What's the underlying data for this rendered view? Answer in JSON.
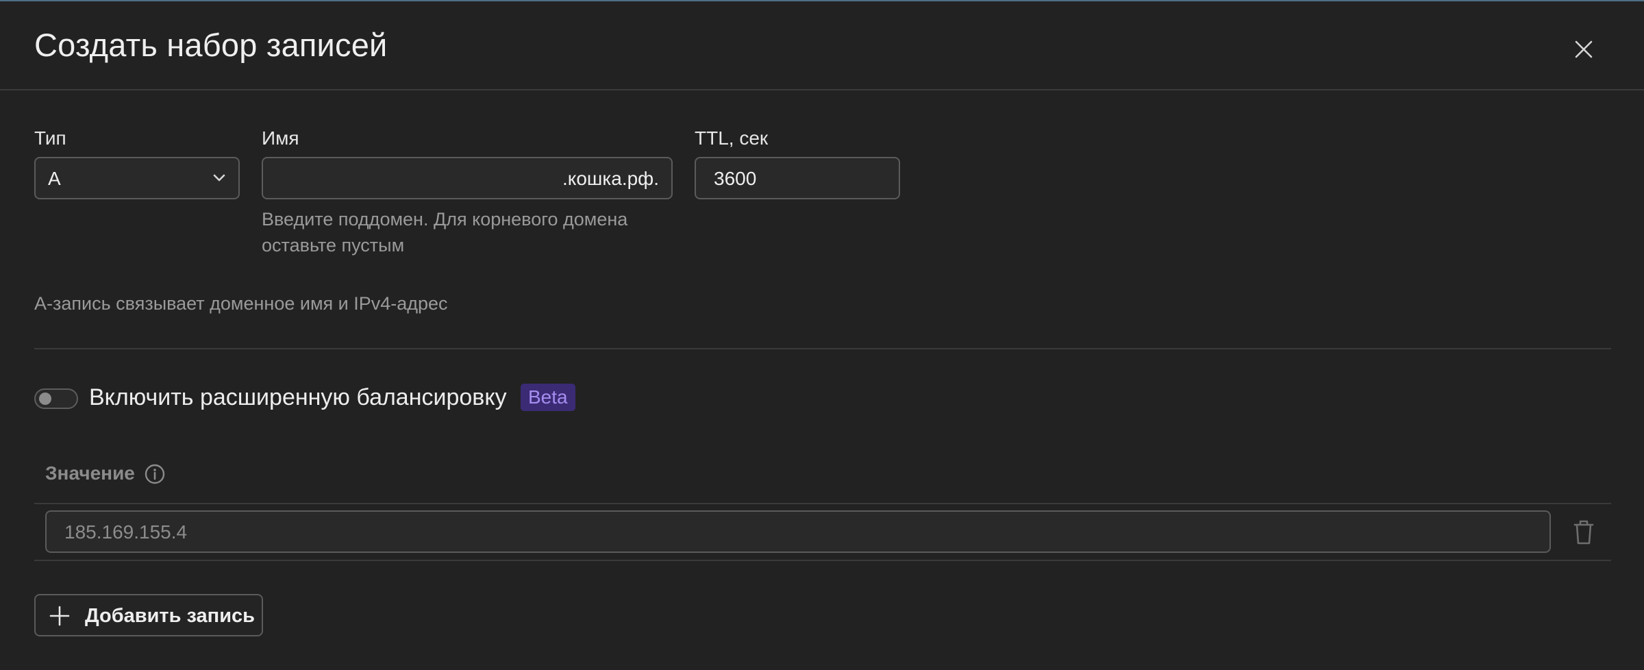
{
  "dialog": {
    "title": "Создать набор записей",
    "close_icon": "close-icon"
  },
  "form": {
    "type": {
      "label": "Тип",
      "value": "A",
      "icon": "chevron-down-icon"
    },
    "name": {
      "label": "Имя",
      "suffix": ".кошка.рф.",
      "hint_line1": "Введите поддомен. Для корневого домена",
      "hint_line2": "оставьте пустым"
    },
    "ttl": {
      "label": "TTL, сек",
      "value": "3600"
    },
    "record_description": "A-запись связывает доменное имя и IPv4-адрес"
  },
  "balancing": {
    "toggle_on": false,
    "label": "Включить расширенную балансировку",
    "badge": "Beta",
    "badge_text_color": "#a68df0",
    "badge_bg_color": "#3b2b74"
  },
  "values_table": {
    "column_header": "Значение",
    "info_icon": "info-icon",
    "rows": [
      {
        "value": "185.169.155.4",
        "delete_icon": "trash-icon"
      }
    ]
  },
  "add_record": {
    "label": "Добавить запись",
    "icon": "plus-icon"
  }
}
